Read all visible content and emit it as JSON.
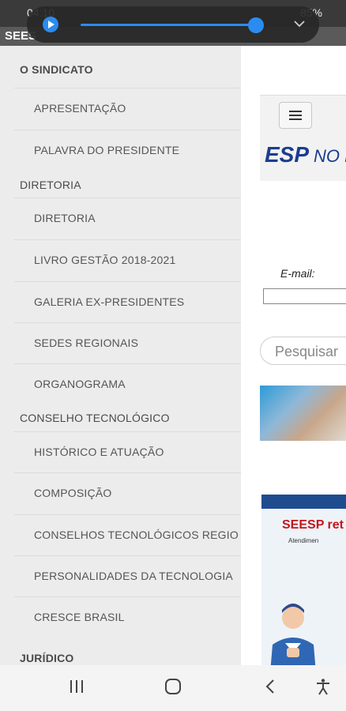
{
  "status": {
    "time": "04:10",
    "battery": "85%"
  },
  "appbar": {
    "title": "SEES"
  },
  "drawer": {
    "sections": [
      {
        "label": "O SINDICATO",
        "bold": true
      },
      {
        "label": "DIRETORIA",
        "bold": false
      },
      {
        "label": "CONSELHO TECNOLÓGICO",
        "bold": false
      },
      {
        "label": "JURÍDICO",
        "bold": true
      }
    ],
    "items": [
      {
        "label": "APRESENTAÇÃO"
      },
      {
        "label": "PALAVRA DO PRESIDENTE"
      },
      {
        "label": "DIRETORIA"
      },
      {
        "label": "LIVRO GESTÃO 2018-2021"
      },
      {
        "label": "GALERIA EX-PRESIDENTES"
      },
      {
        "label": "SEDES REGIONAIS"
      },
      {
        "label": "ORGANOGRAMA"
      },
      {
        "label": "HISTÓRICO E ATUAÇÃO"
      },
      {
        "label": "COMPOSIÇÃO"
      },
      {
        "label": "CONSELHOS TECNOLÓGICOS REGIO"
      },
      {
        "label": "PERSONALIDADES DA TECNOLOGIA"
      },
      {
        "label": "CRESCE BRASIL"
      }
    ]
  },
  "web": {
    "logo_main": "ESP",
    "logo_rest": "NO E",
    "email_label": "E-mail:",
    "search_placeholder": "Pesquisar",
    "banner_title": "SEESP ret",
    "banner_sub": "Atendimen"
  },
  "colors": {
    "accent": "#2a8cf0",
    "drawer_bg": "#ececec",
    "logo": "#1b3d8f",
    "banner_red": "#c4161c"
  }
}
